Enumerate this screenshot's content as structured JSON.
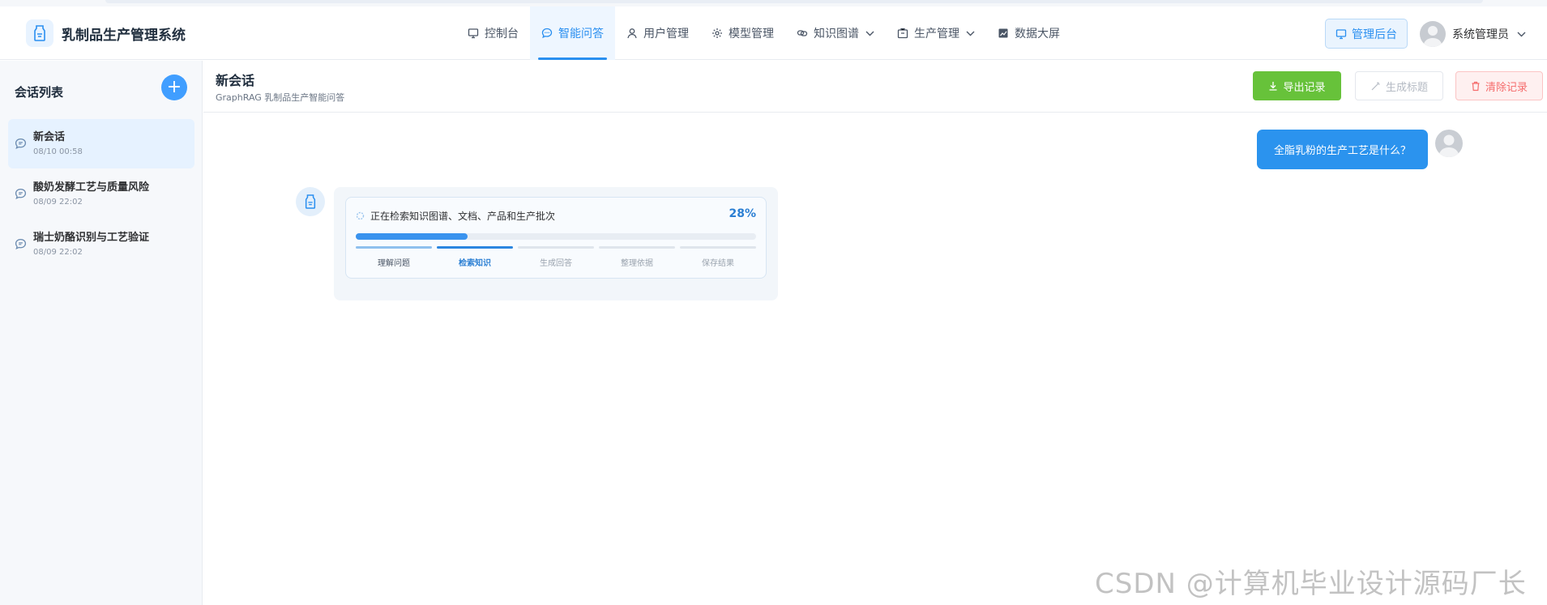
{
  "app": {
    "title": "乳制品生产管理系统"
  },
  "nav": {
    "items": [
      {
        "label": "控制台",
        "icon": "monitor-icon",
        "active": false,
        "has_caret": false
      },
      {
        "label": "智能问答",
        "icon": "chat-icon",
        "active": true,
        "has_caret": false
      },
      {
        "label": "用户管理",
        "icon": "user-icon",
        "active": false,
        "has_caret": false
      },
      {
        "label": "模型管理",
        "icon": "gear-icon",
        "active": false,
        "has_caret": false
      },
      {
        "label": "知识图谱",
        "icon": "link-icon",
        "active": false,
        "has_caret": true
      },
      {
        "label": "生产管理",
        "icon": "box-icon",
        "active": false,
        "has_caret": true
      },
      {
        "label": "数据大屏",
        "icon": "chart-icon",
        "active": false,
        "has_caret": false
      }
    ]
  },
  "header": {
    "admin_label": "管理后台",
    "user_name": "系统管理员"
  },
  "sidebar": {
    "title": "会话列表",
    "conversations": [
      {
        "title": "新会话",
        "time": "08/10 00:58",
        "active": true
      },
      {
        "title": "酸奶发酵工艺与质量风险",
        "time": "08/09 22:02",
        "active": false
      },
      {
        "title": "瑞士奶酪识别与工艺验证",
        "time": "08/09 22:02",
        "active": false
      }
    ]
  },
  "main": {
    "title": "新会话",
    "subtitle": "GraphRAG 乳制品生产智能问答",
    "export_label": "导出记录",
    "generate_label": "生成标题",
    "clear_label": "清除记录"
  },
  "chat": {
    "user_message": "全脂乳粉的生产工艺是什么？",
    "progress": {
      "status": "正在检索知识图谱、文档、产品和生产批次",
      "percent_text": "28%",
      "percent": 28,
      "steps": [
        {
          "label": "理解问题",
          "state": "done"
        },
        {
          "label": "检索知识",
          "state": "current"
        },
        {
          "label": "生成回答",
          "state": "pending"
        },
        {
          "label": "整理依据",
          "state": "pending"
        },
        {
          "label": "保存结果",
          "state": "pending"
        }
      ]
    }
  },
  "colors": {
    "primary": "#2a8ff0",
    "success": "#67c23a",
    "danger": "#f56c6c"
  },
  "watermark": "CSDN @计算机毕业设计源码厂长"
}
